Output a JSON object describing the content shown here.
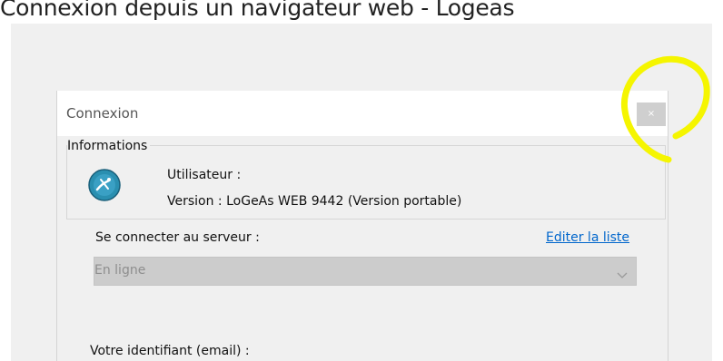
{
  "caption": "Connexion depuis un navigateur web - Logeas",
  "dialog": {
    "title": "Connexion",
    "close_label": "×",
    "info": {
      "legend": "Informations",
      "user_label": "Utilisateur :",
      "version_label": "Version : LoGeAs WEB 9442 (Version portable)"
    },
    "server_label": "Se connecter au serveur :",
    "edit_link": "Editer la liste",
    "server_select": {
      "selected": "En ligne"
    },
    "identifier_label": "Votre identifiant (email) :"
  },
  "colors": {
    "accent": "#0066cc",
    "highlight": "#f5f500",
    "logo": "#2a8fb0"
  },
  "icons": {
    "logo": "app-logo-icon",
    "close": "close-icon",
    "dropdown": "chevron-down-icon"
  }
}
